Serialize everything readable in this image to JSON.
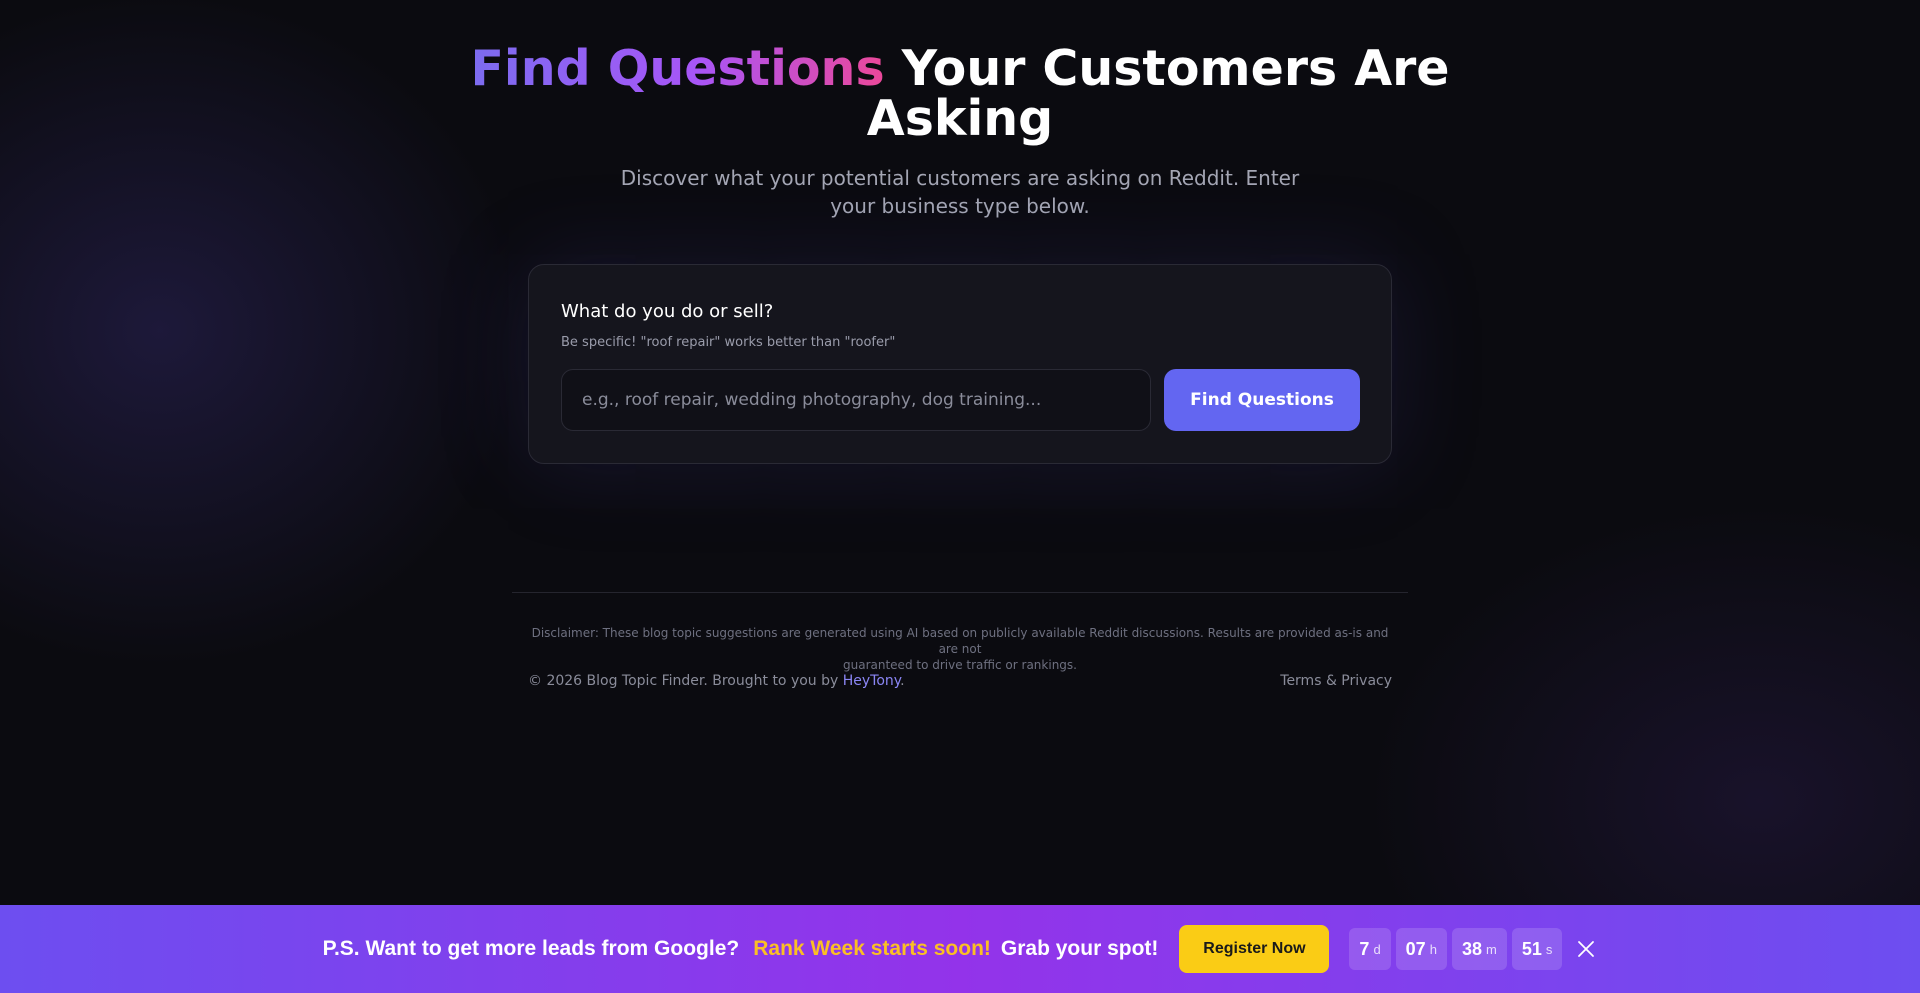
{
  "hero": {
    "headline_highlight": "Find Questions",
    "headline_rest": "Your Customers Are",
    "headline_line2": "Asking",
    "subtitle_line1": "Discover what your potential customers are asking on Reddit. Enter",
    "subtitle_line2": "your business type below."
  },
  "form": {
    "label": "What do you do or sell?",
    "hint": "Be specific! \"roof repair\" works better than \"roofer\"",
    "input_placeholder": "e.g., roof repair, wedding photography, dog training...",
    "input_value": "",
    "button_label": "Find Questions"
  },
  "footer": {
    "disclaimer_line1": "Disclaimer: These blog topic suggestions are generated using AI based on publicly available Reddit discussions. Results are provided as-is and are not",
    "disclaimer_line2": "guaranteed to drive traffic or rankings.",
    "copyright": "© 2026 Blog Topic Finder. Brought to you by",
    "brand_link": "HeyTony",
    "period": ".",
    "terms_link": "Terms & Privacy"
  },
  "banner": {
    "text_start": "P.S. Want to get more leads from Google?",
    "highlight": "Rank Week starts soon!",
    "text_end": "Grab your spot!",
    "register_label": "Register Now",
    "countdown": [
      {
        "value": "7",
        "unit": "d"
      },
      {
        "value": "07",
        "unit": "h"
      },
      {
        "value": "38",
        "unit": "m"
      },
      {
        "value": "51",
        "unit": "s"
      }
    ],
    "close_icon": "close-icon"
  },
  "colors": {
    "background": "#0b0b10",
    "card": "#15151d",
    "accent": "#6366f1",
    "gradient_start": "#7c6cf0",
    "gradient_end": "#ec4899",
    "banner_start": "#6d4ef0",
    "banner_mid": "#9333ea",
    "banner_highlight": "#fbbf24",
    "register_button": "#facc15",
    "link": "#8b86f5"
  }
}
